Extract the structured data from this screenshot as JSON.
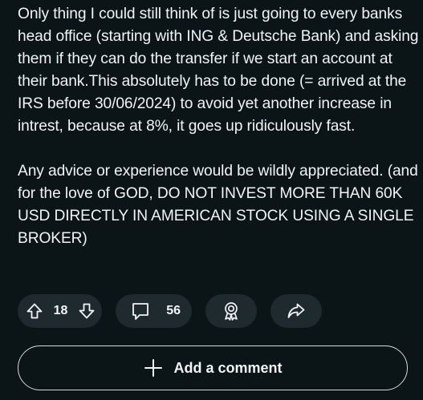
{
  "post": {
    "paragraphs": [
      "Only thing I could still think of is just going to every banks head office (starting with ING & Deutsche Bank) and asking them if they can do the transfer if we start an account at their bank.This absolutely has to be done (= arrived at the IRS before 30/06/2024) to avoid yet another increase in intrest, because at 8%, it goes up ridiculously fast.",
      "Any advice or experience would be wildly appreciated. (and for the love of GOD, DO NOT INVEST MORE THAN 60K USD DIRECTLY IN AMERICAN STOCK USING A SINGLE BROKER)"
    ]
  },
  "actions": {
    "vote_count": "18",
    "comment_count": "56"
  },
  "add_comment": {
    "label": "Add a comment"
  },
  "icons": {
    "upvote": "upvote-arrow-icon",
    "downvote": "downvote-arrow-icon",
    "comment": "comment-bubble-icon",
    "award": "award-icon",
    "share": "share-arrow-icon",
    "plus": "plus-icon"
  },
  "colors": {
    "background": "#0b1416",
    "pill_background": "#1f2a2e",
    "text": "#f2f4f5",
    "border": "#d7dadc"
  }
}
